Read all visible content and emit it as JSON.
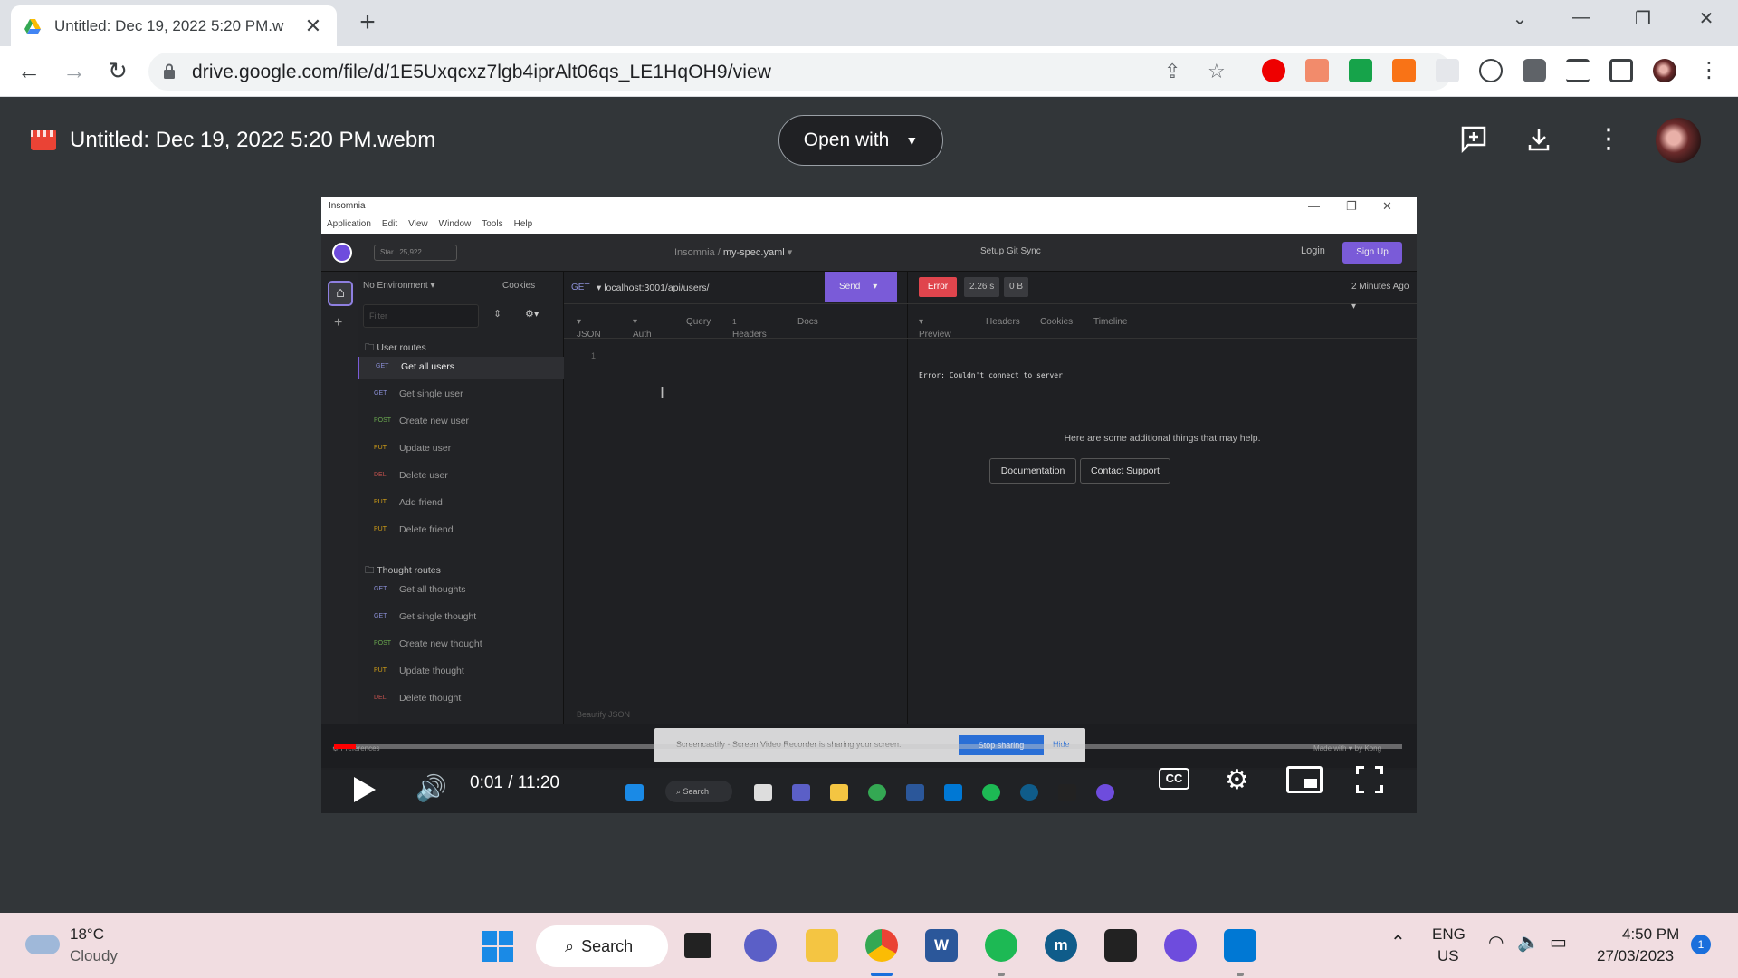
{
  "browser": {
    "tab_title": "Untitled: Dec 19, 2022 5:20 PM.w",
    "url": "drive.google.com/file/d/1E5Uxqcxz7lgb4iprAlt06qs_LE1HqOH9/view"
  },
  "viewer": {
    "file_name": "Untitled: Dec 19, 2022 5:20 PM.webm",
    "open_with_label": "Open with"
  },
  "insomnia": {
    "app_name": "Insomnia",
    "menu": [
      "Application",
      "Edit",
      "View",
      "Window",
      "Tools",
      "Help"
    ],
    "star_label": "Star",
    "star_count": "25,922",
    "breadcrumb_root": "Insomnia",
    "breadcrumb_sep": "/",
    "breadcrumb_doc": "my-spec.yaml",
    "git_sync": "Setup Git Sync",
    "login": "Login",
    "signup": "Sign Up",
    "environment": "No Environment",
    "cookies": "Cookies",
    "filter_placeholder": "Filter",
    "folders": {
      "user_routes": "User routes",
      "thought_routes": "Thought routes"
    },
    "user_requests": [
      {
        "method": "GET",
        "name": "Get all users"
      },
      {
        "method": "GET",
        "name": "Get single user"
      },
      {
        "method": "POST",
        "name": "Create new user"
      },
      {
        "method": "PUT",
        "name": "Update user"
      },
      {
        "method": "DEL",
        "name": "Delete user"
      },
      {
        "method": "PUT",
        "name": "Add friend"
      },
      {
        "method": "PUT",
        "name": "Delete friend"
      }
    ],
    "thought_requests": [
      {
        "method": "GET",
        "name": "Get all thoughts"
      },
      {
        "method": "GET",
        "name": "Get single thought"
      },
      {
        "method": "POST",
        "name": "Create new thought"
      },
      {
        "method": "PUT",
        "name": "Update thought"
      },
      {
        "method": "DEL",
        "name": "Delete thought"
      }
    ],
    "request_method": "GET",
    "request_url": "localhost:3001/api/users/",
    "send": "Send",
    "body_tabs": [
      "JSON",
      "Auth",
      "Query",
      "Headers",
      "Docs"
    ],
    "headers_count": "1",
    "line_number": "1",
    "beautify": "Beautify JSON",
    "status": "Error",
    "time": "2.26 s",
    "size": "0 B",
    "ago": "2 Minutes Ago",
    "response_tabs": [
      "Preview",
      "Headers",
      "Cookies",
      "Timeline"
    ],
    "error_text": "Error: Couldn't connect to server",
    "help_text": "Here are some additional things that may help.",
    "documentation": "Documentation",
    "contact_support": "Contact Support",
    "preferences": "Preferences",
    "made_with": "Made with ♥ by Kong",
    "share_text": "Screencastify - Screen Video Recorder is sharing your screen.",
    "stop_sharing": "Stop sharing",
    "hide": "Hide",
    "inner_search": "Search"
  },
  "player": {
    "current_time": "0:01",
    "duration": "11:20",
    "time_display": "0:01 / 11:20",
    "progress": 0.001,
    "cc_label": "CC"
  },
  "taskbar": {
    "temperature": "18°C",
    "weather": "Cloudy",
    "search_label": "Search",
    "lang_top": "ENG",
    "lang_bottom": "US",
    "time": "4:50 PM",
    "date": "27/03/2023",
    "notifications": "1"
  },
  "colors": {
    "accent_purple": "#7a5bd8",
    "error_red": "#e0454d",
    "progress_red": "#ff0000"
  }
}
